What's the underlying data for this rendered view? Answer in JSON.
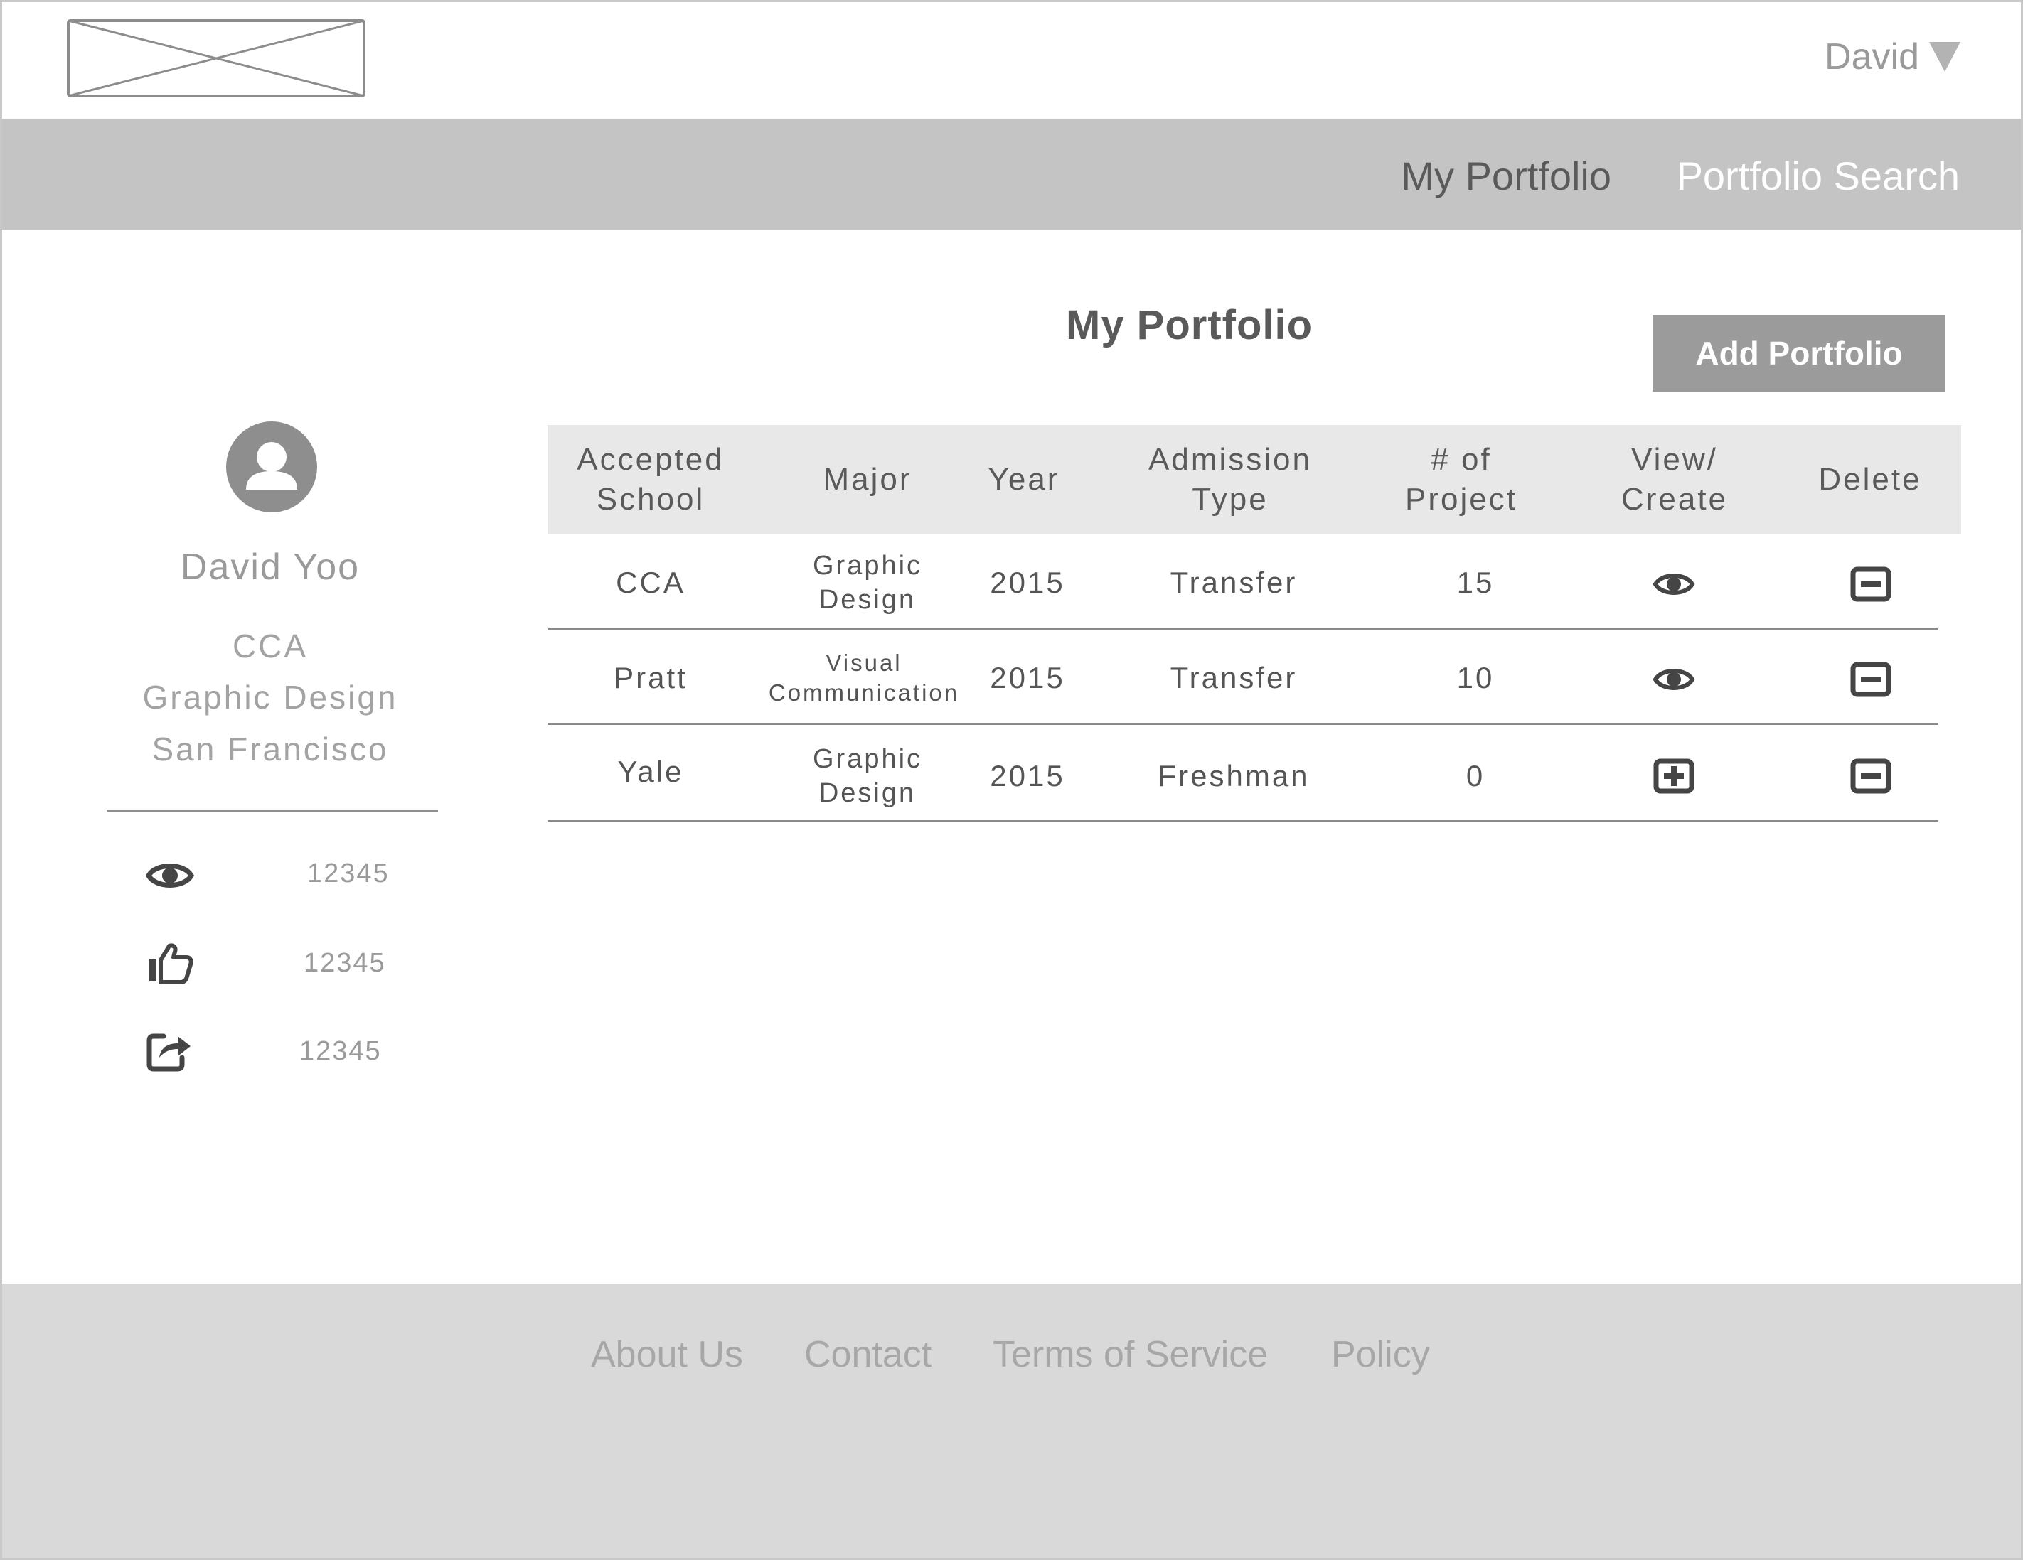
{
  "header": {
    "user_name": "David"
  },
  "nav": {
    "my_portfolio": "My Portfolio",
    "portfolio_search": "Portfolio Search"
  },
  "main": {
    "title": "My Portfolio",
    "add_button": "Add Portfolio"
  },
  "profile": {
    "name": "David Yoo",
    "school": "CCA",
    "major": "Graphic Design",
    "city": "San Francisco",
    "stats": {
      "views": "12345",
      "likes": "12345",
      "shares": "12345"
    }
  },
  "table": {
    "headers": {
      "school_line1": "Accepted",
      "school_line2": "School",
      "major": "Major",
      "year": "Year",
      "type_line1": "Admission",
      "type_line2": "Type",
      "projects_line1": "# of",
      "projects_line2": "Project",
      "view_line1": "View/",
      "view_line2": "Create",
      "delete": "Delete"
    },
    "rows": [
      {
        "school": "CCA",
        "major_line1": "Graphic",
        "major_line2": "Design",
        "year": "2015",
        "type": "Transfer",
        "projects": "15",
        "action_icon": "eye-icon"
      },
      {
        "school": "Pratt",
        "major_line1": "Visual",
        "major_line2": "Communication",
        "year": "2015",
        "type": "Transfer",
        "projects": "10",
        "action_icon": "eye-icon"
      },
      {
        "school": "Yale",
        "major_line1": "Graphic",
        "major_line2": "Design",
        "year": "2015",
        "type": "Freshman",
        "projects": "0",
        "action_icon": "plus-square-icon"
      }
    ]
  },
  "footer": {
    "about": "About Us",
    "contact": "Contact",
    "terms": "Terms of Service",
    "policy": "Policy"
  },
  "icons": {
    "logo": "image-placeholder",
    "user_caret": "triangle-down-icon",
    "avatar": "user-silhouette-icon",
    "views": "eye-icon",
    "likes": "thumbs-up-icon",
    "shares": "share-icon",
    "delete": "minus-square-icon"
  },
  "colors": {
    "navbar": "#c4c4c4",
    "footer": "#d9d9d9",
    "button": "#9b9b9b",
    "table_header": "#e8e8e8",
    "icon": "#454545"
  }
}
